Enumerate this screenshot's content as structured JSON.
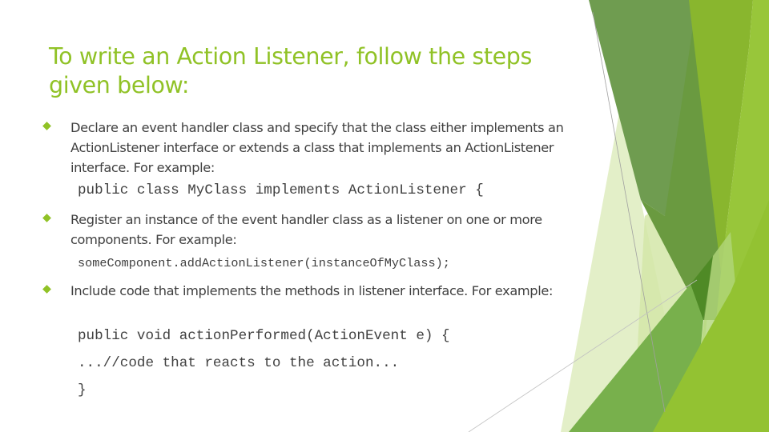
{
  "slide": {
    "title": "To write an Action Listener, follow the steps given below:",
    "bullets": [
      {
        "icon": "diamond-bullet-icon",
        "text": "Declare an event handler class and specify that the class either implements an ActionListener interface or extends a class that implements an ActionListener interface. For example:"
      },
      {
        "icon": "diamond-bullet-icon",
        "text": "Register an instance of the event handler class as a listener on one or more components. For example:"
      },
      {
        "icon": "diamond-bullet-icon",
        "text": "Include code that implements the methods in listener interface. For example:"
      }
    ],
    "code": [
      "public class MyClass implements ActionListener {",
      "someComponent.addActionListener(instanceOfMyClass);",
      "public void actionPerformed(ActionEvent e) {",
      "...//code that reacts to the action...",
      "}"
    ]
  },
  "theme": {
    "accent": "#90c226",
    "text_color": "#404040",
    "decor_colors": [
      "#6d9b4f",
      "#6a9a3f",
      "#8bb52e",
      "#9ac73c",
      "#7bb34a",
      "#d6e8b0",
      "#4f8a26"
    ]
  }
}
